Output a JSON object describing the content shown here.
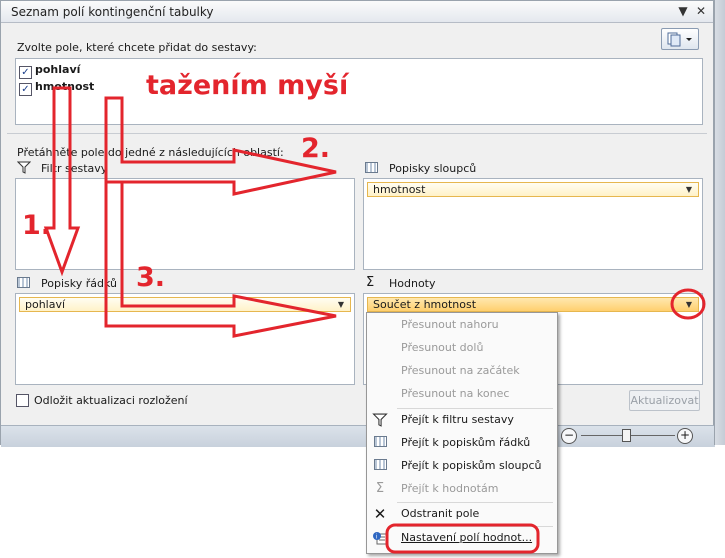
{
  "window": {
    "title": "Seznam polí kontingenční tabulky",
    "dropdown_glyph": "▼",
    "close_glyph": "✕"
  },
  "instruction": "Zvolte pole, které chcete přidat do sestavy:",
  "fields": [
    {
      "label": "pohlaví",
      "checked": true
    },
    {
      "label": "hmotnost",
      "checked": true
    }
  ],
  "drag_instruction": "Přetáhněte pole do jedné z následujících oblastí:",
  "areas": {
    "filter": {
      "label": "Filtr sestavy",
      "icon": "filter-icon"
    },
    "columns": {
      "label": "Popisky sloupců",
      "icon": "columns-icon",
      "item": "hmotnost"
    },
    "rows": {
      "label": "Popisky řádků",
      "icon": "rows-icon",
      "item": "pohlaví"
    },
    "values": {
      "label": "Hodnoty",
      "icon": "sigma-icon",
      "item": "Součet z hmotnost"
    }
  },
  "defer_label": "Odložit aktualizaci rozložení",
  "update_button": "Aktualizovat",
  "context_menu": {
    "items": [
      {
        "label": "Přesunout nahoru",
        "disabled": true,
        "icon": ""
      },
      {
        "label": "Přesunout dolů",
        "disabled": true,
        "icon": ""
      },
      {
        "label": "Přesunout na začátek",
        "disabled": true,
        "icon": ""
      },
      {
        "label": "Přesunout na konec",
        "disabled": true,
        "icon": ""
      },
      {
        "label": "Přejít k filtru sestavy",
        "disabled": false,
        "icon": "filter-icon"
      },
      {
        "label": "Přejít k popiskům řádků",
        "disabled": false,
        "icon": "rows-icon"
      },
      {
        "label": "Přejít k popiskům sloupců",
        "disabled": false,
        "icon": "columns-icon"
      },
      {
        "label": "Přejít k hodnotám",
        "disabled": true,
        "icon": "sigma-icon"
      },
      {
        "label": "Odstranit pole",
        "disabled": false,
        "icon": "remove-icon"
      },
      {
        "label": "Nastavení polí hodnot...",
        "disabled": false,
        "icon": "settings-icon"
      }
    ]
  },
  "annotations": {
    "drag_text": "tažením myší",
    "step1": "1.",
    "step2": "2.",
    "step3": "3.",
    "color": "#e3252d"
  },
  "colors": {
    "pill_border": "#e6b74f",
    "pill_bg": "#fff2c8",
    "panel_bg": "#f0f0f0"
  }
}
